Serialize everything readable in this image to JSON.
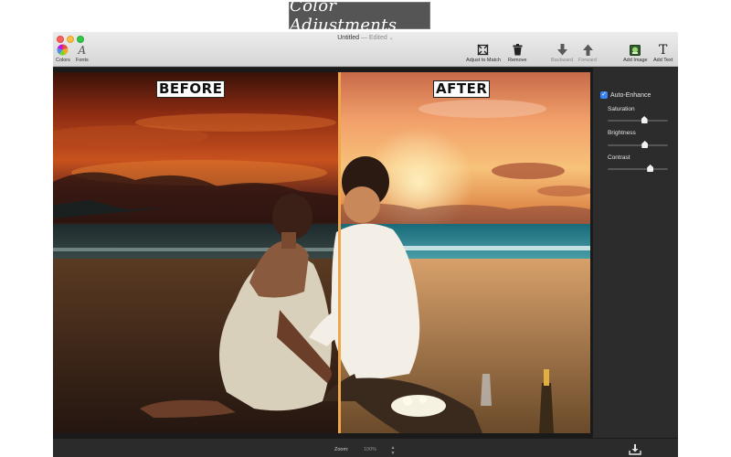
{
  "banner": {
    "title": "Color Adjustments"
  },
  "window": {
    "title": "Untitled",
    "status": "Edited",
    "chevron": "⌄"
  },
  "toolbar": {
    "left": [
      {
        "label": "Colors",
        "icon": "color-wheel-icon"
      },
      {
        "label": "Fonts",
        "icon": "font-a-icon"
      }
    ],
    "right": [
      {
        "label": "Adjust to Match",
        "icon": "adjust-frame-icon",
        "enabled": true
      },
      {
        "label": "Remove",
        "icon": "trash-icon",
        "enabled": true
      },
      {
        "label": "Backward",
        "icon": "arrow-down-icon",
        "enabled": false
      },
      {
        "label": "Forward",
        "icon": "arrow-up-icon",
        "enabled": false
      },
      {
        "label": "Add Image",
        "icon": "image-icon",
        "enabled": true
      },
      {
        "label": "Add Text",
        "icon": "text-t-icon",
        "enabled": true
      }
    ]
  },
  "canvas": {
    "before_label": "BEFORE",
    "after_label": "AFTER"
  },
  "sidebar": {
    "auto_enhance": {
      "label": "Auto-Enhance",
      "checked": true
    },
    "sliders": [
      {
        "label": "Saturation",
        "value": 0.6
      },
      {
        "label": "Brightness",
        "value": 0.61
      },
      {
        "label": "Contrast",
        "value": 0.7
      }
    ]
  },
  "bottom": {
    "zoom_label": "Zoom:",
    "zoom_value": "100%",
    "stepper": "▲▼",
    "export_icon": "export-download-icon"
  },
  "colors": {
    "accent": "#3a82f7",
    "divider": "#f0a64a"
  }
}
